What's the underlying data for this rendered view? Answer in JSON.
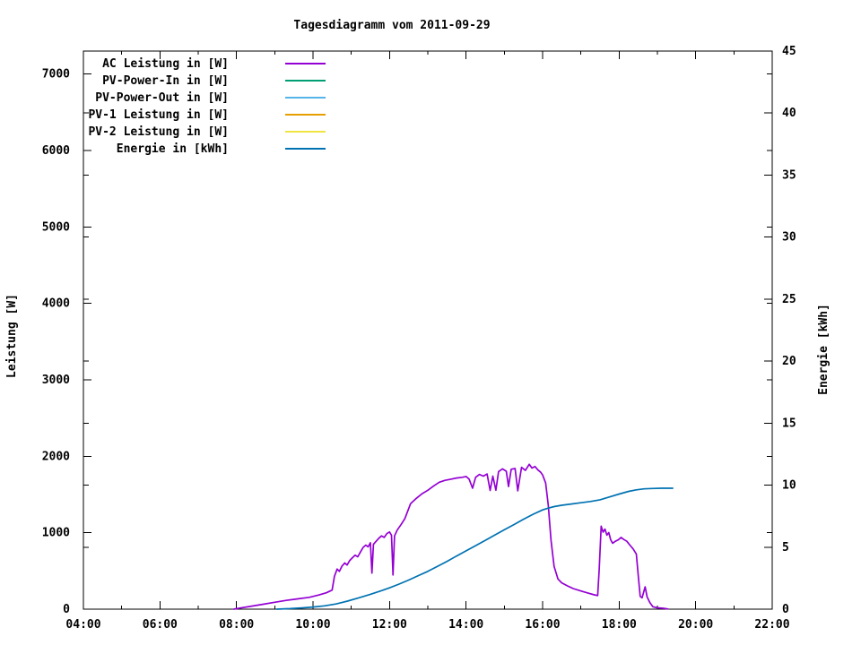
{
  "title": "Tagesdiagramm vom 2011-09-29",
  "colors": {
    "background": "#ffffff",
    "axis": "#000000",
    "ac_leistung": "#9400d3",
    "pv_power_in": "#009e73",
    "pv_power_out": "#56b4e9",
    "pv1_leistung": "#e69f00",
    "pv2_leistung": "#f0e442",
    "energie": "#0072b2"
  },
  "axes": {
    "left": {
      "label": "Leistung [W]",
      "tick_values": [
        0,
        1000,
        2000,
        3000,
        4000,
        5000,
        6000,
        7000
      ],
      "range": [
        0,
        7300
      ]
    },
    "right": {
      "label": "Energie [kWh]",
      "tick_values": [
        0,
        5,
        10,
        15,
        20,
        25,
        30,
        35,
        40,
        45
      ],
      "range": [
        0,
        45
      ]
    },
    "x": {
      "labels": [
        "04:00",
        "06:00",
        "08:00",
        "10:00",
        "12:00",
        "14:00",
        "16:00",
        "18:00",
        "20:00",
        "22:00"
      ],
      "range_hours": [
        4,
        22
      ],
      "major_step_hours": 2,
      "minor_step_hours": 1
    }
  },
  "legend": {
    "position": "top-left-inside",
    "items": [
      {
        "label": "AC Leistung in [W]",
        "color": "#9400d3"
      },
      {
        "label": "PV-Power-In in [W]",
        "color": "#009e73"
      },
      {
        "label": "PV-Power-Out in [W]",
        "color": "#56b4e9"
      },
      {
        "label": "PV-1 Leistung in [W]",
        "color": "#e69f00"
      },
      {
        "label": "PV-2 Leistung in [W]",
        "color": "#f0e442"
      },
      {
        "label": "Energie in [kWh]",
        "color": "#0072b2"
      }
    ]
  },
  "chart_data": {
    "type": "line",
    "title": "Tagesdiagramm vom 2011-09-29",
    "grid": false,
    "legend_position": "top-left-inside",
    "x_axis": {
      "unit": "time of day (hours)",
      "range_hours": [
        4,
        22
      ],
      "tick_labels": [
        "04:00",
        "06:00",
        "08:00",
        "10:00",
        "12:00",
        "14:00",
        "16:00",
        "18:00",
        "20:00",
        "22:00"
      ],
      "minor_tick_hours": 1
    },
    "y_axis_left": {
      "label": "Leistung [W]",
      "range": [
        0,
        7300
      ],
      "ticks": [
        0,
        1000,
        2000,
        3000,
        4000,
        5000,
        6000,
        7000
      ]
    },
    "y_axis_right": {
      "label": "Energie [kWh]",
      "range": [
        0,
        45
      ],
      "ticks": [
        0,
        5,
        10,
        15,
        20,
        25,
        30,
        35,
        40,
        45
      ]
    },
    "series": [
      {
        "name": "AC Leistung in [W]",
        "axis": "left",
        "color": "#9400d3",
        "points": [
          [
            7.93,
            0
          ],
          [
            8.1,
            15
          ],
          [
            8.4,
            40
          ],
          [
            8.7,
            65
          ],
          [
            9.0,
            90
          ],
          [
            9.3,
            115
          ],
          [
            9.6,
            135
          ],
          [
            9.9,
            155
          ],
          [
            10.15,
            185
          ],
          [
            10.35,
            215
          ],
          [
            10.5,
            250
          ],
          [
            10.56,
            430
          ],
          [
            10.63,
            525
          ],
          [
            10.69,
            495
          ],
          [
            10.76,
            565
          ],
          [
            10.83,
            605
          ],
          [
            10.89,
            578
          ],
          [
            10.96,
            638
          ],
          [
            11.03,
            672
          ],
          [
            11.1,
            705
          ],
          [
            11.17,
            685
          ],
          [
            11.24,
            748
          ],
          [
            11.31,
            808
          ],
          [
            11.38,
            838
          ],
          [
            11.44,
            815
          ],
          [
            11.5,
            868
          ],
          [
            11.54,
            472
          ],
          [
            11.58,
            848
          ],
          [
            11.65,
            888
          ],
          [
            11.72,
            928
          ],
          [
            11.79,
            958
          ],
          [
            11.86,
            938
          ],
          [
            11.93,
            988
          ],
          [
            12.0,
            1010
          ],
          [
            12.05,
            968
          ],
          [
            12.09,
            448
          ],
          [
            12.13,
            958
          ],
          [
            12.2,
            1035
          ],
          [
            12.3,
            1105
          ],
          [
            12.4,
            1185
          ],
          [
            12.55,
            1380
          ],
          [
            12.7,
            1450
          ],
          [
            12.85,
            1510
          ],
          [
            13.0,
            1555
          ],
          [
            13.15,
            1610
          ],
          [
            13.3,
            1660
          ],
          [
            13.45,
            1685
          ],
          [
            13.6,
            1700
          ],
          [
            13.75,
            1715
          ],
          [
            13.9,
            1725
          ],
          [
            14.0,
            1735
          ],
          [
            14.08,
            1700
          ],
          [
            14.17,
            1582
          ],
          [
            14.25,
            1725
          ],
          [
            14.35,
            1762
          ],
          [
            14.45,
            1740
          ],
          [
            14.55,
            1768
          ],
          [
            14.63,
            1552
          ],
          [
            14.7,
            1740
          ],
          [
            14.78,
            1556
          ],
          [
            14.85,
            1800
          ],
          [
            14.95,
            1835
          ],
          [
            15.05,
            1805
          ],
          [
            15.11,
            1604
          ],
          [
            15.18,
            1830
          ],
          [
            15.28,
            1840
          ],
          [
            15.35,
            1548
          ],
          [
            15.45,
            1855
          ],
          [
            15.55,
            1815
          ],
          [
            15.65,
            1895
          ],
          [
            15.72,
            1845
          ],
          [
            15.8,
            1865
          ],
          [
            15.88,
            1820
          ],
          [
            15.95,
            1790
          ],
          [
            16.0,
            1755
          ],
          [
            16.08,
            1650
          ],
          [
            16.15,
            1350
          ],
          [
            16.22,
            900
          ],
          [
            16.3,
            560
          ],
          [
            16.4,
            395
          ],
          [
            16.5,
            345
          ],
          [
            16.65,
            305
          ],
          [
            16.8,
            270
          ],
          [
            17.0,
            238
          ],
          [
            17.2,
            208
          ],
          [
            17.35,
            188
          ],
          [
            17.44,
            178
          ],
          [
            17.48,
            520
          ],
          [
            17.53,
            1085
          ],
          [
            17.58,
            1008
          ],
          [
            17.63,
            1048
          ],
          [
            17.68,
            968
          ],
          [
            17.73,
            1002
          ],
          [
            17.78,
            908
          ],
          [
            17.83,
            862
          ],
          [
            17.9,
            888
          ],
          [
            17.98,
            908
          ],
          [
            18.05,
            938
          ],
          [
            18.12,
            912
          ],
          [
            18.2,
            888
          ],
          [
            18.28,
            838
          ],
          [
            18.36,
            792
          ],
          [
            18.45,
            722
          ],
          [
            18.5,
            432
          ],
          [
            18.55,
            168
          ],
          [
            18.6,
            148
          ],
          [
            18.68,
            292
          ],
          [
            18.73,
            162
          ],
          [
            18.8,
            88
          ],
          [
            18.88,
            32
          ],
          [
            19.0,
            18
          ],
          [
            19.15,
            12
          ],
          [
            19.28,
            2
          ]
        ]
      },
      {
        "name": "PV-Power-In in [W]",
        "axis": "left",
        "color": "#009e73",
        "points": []
      },
      {
        "name": "PV-Power-Out in [W]",
        "axis": "left",
        "color": "#56b4e9",
        "points": []
      },
      {
        "name": "PV-1 Leistung in [W]",
        "axis": "left",
        "color": "#e69f00",
        "points": []
      },
      {
        "name": "PV-2 Leistung in [W]",
        "axis": "left",
        "color": "#f0e442",
        "points": []
      },
      {
        "name": "Energie in [kWh]",
        "axis": "right",
        "color": "#0072b2",
        "points": [
          [
            9.05,
            0
          ],
          [
            9.4,
            0.04
          ],
          [
            9.7,
            0.1
          ],
          [
            10.0,
            0.17
          ],
          [
            10.3,
            0.27
          ],
          [
            10.6,
            0.42
          ],
          [
            10.9,
            0.65
          ],
          [
            11.2,
            0.92
          ],
          [
            11.5,
            1.2
          ],
          [
            11.8,
            1.5
          ],
          [
            12.0,
            1.72
          ],
          [
            12.25,
            2.02
          ],
          [
            12.5,
            2.35
          ],
          [
            12.75,
            2.7
          ],
          [
            13.0,
            3.05
          ],
          [
            13.25,
            3.45
          ],
          [
            13.5,
            3.85
          ],
          [
            13.75,
            4.28
          ],
          [
            14.0,
            4.7
          ],
          [
            14.25,
            5.12
          ],
          [
            14.5,
            5.55
          ],
          [
            14.75,
            5.98
          ],
          [
            15.0,
            6.4
          ],
          [
            15.25,
            6.82
          ],
          [
            15.5,
            7.25
          ],
          [
            15.75,
            7.65
          ],
          [
            16.0,
            8.0
          ],
          [
            16.15,
            8.15
          ],
          [
            16.3,
            8.27
          ],
          [
            16.5,
            8.38
          ],
          [
            16.75,
            8.48
          ],
          [
            17.0,
            8.58
          ],
          [
            17.25,
            8.68
          ],
          [
            17.5,
            8.82
          ],
          [
            17.75,
            9.05
          ],
          [
            18.0,
            9.28
          ],
          [
            18.25,
            9.5
          ],
          [
            18.45,
            9.62
          ],
          [
            18.65,
            9.7
          ],
          [
            18.85,
            9.73
          ],
          [
            19.1,
            9.75
          ],
          [
            19.4,
            9.75
          ]
        ]
      }
    ]
  }
}
